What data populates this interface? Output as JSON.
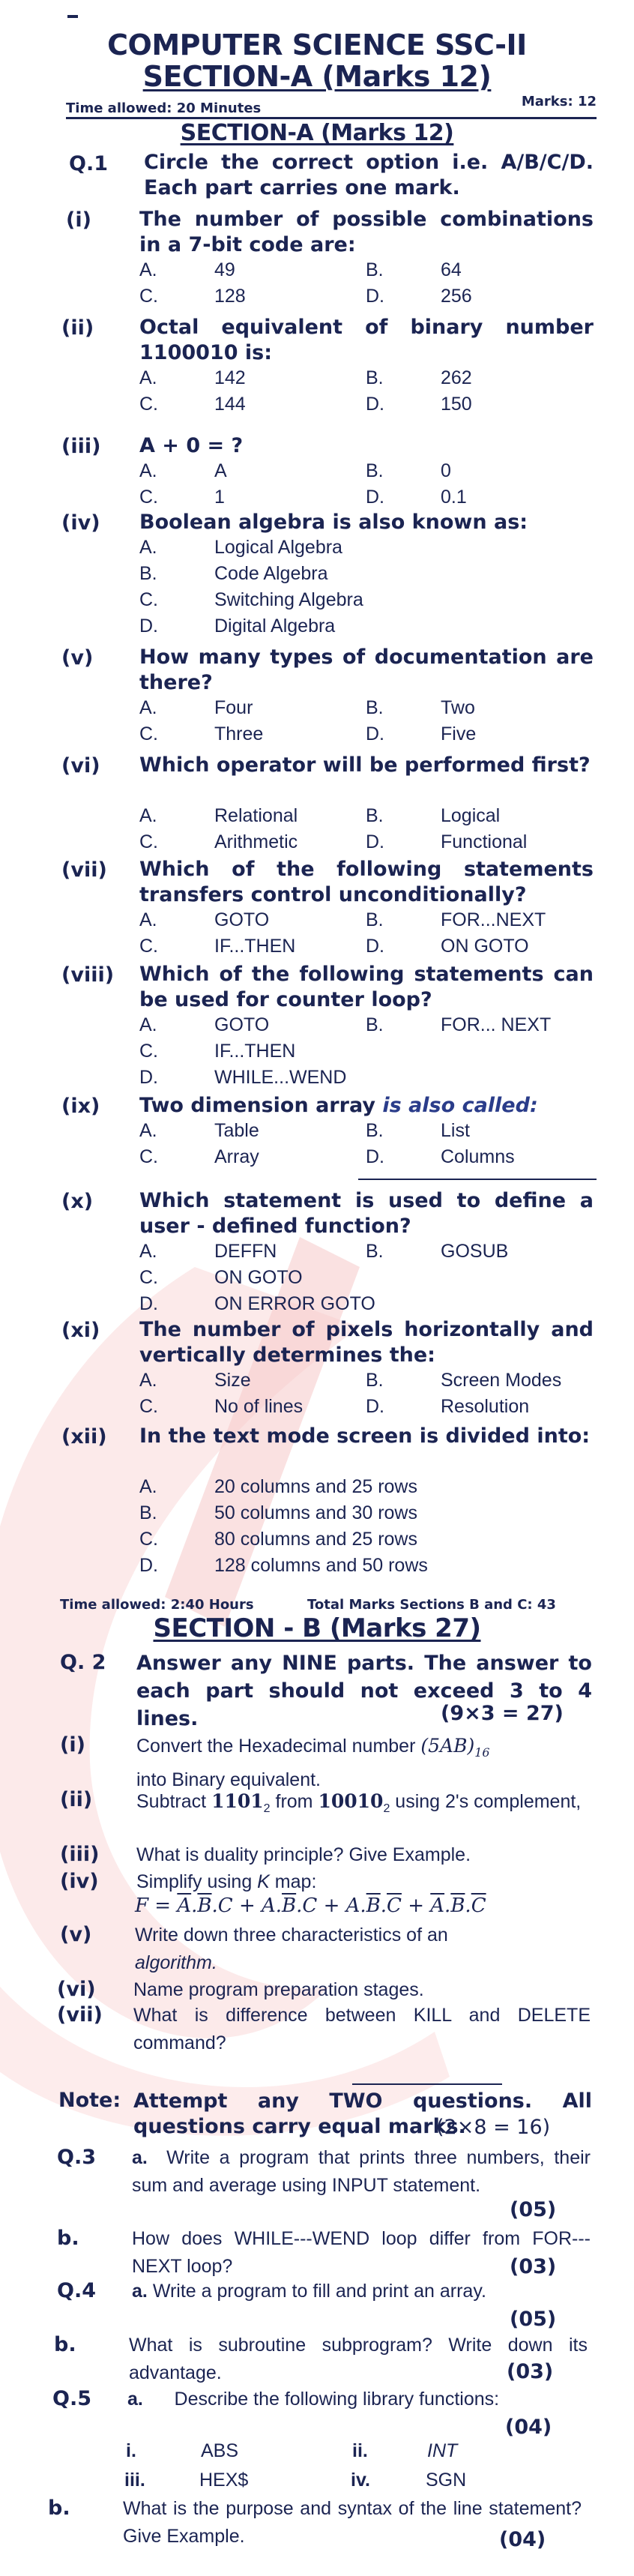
{
  "header": {
    "subject_title": "COMPUTER SCIENCE SSC-II",
    "section_a_heading": "SECTION-A (Marks 12)",
    "time_allowed": "Time allowed: 20 Minutes",
    "marks": "Marks: 12",
    "section_a_subheading": "SECTION-A (Marks 12)"
  },
  "section_a": {
    "q1_label": "Q.1",
    "q1_instructions": "Circle the correct option i.e. A/B/C/D. Each part carries one mark.",
    "mcqs": [
      {
        "num": "(i)",
        "question": "The number of possible combinations in a 7-bit code are:",
        "options": [
          [
            "A.",
            "49"
          ],
          [
            "B.",
            "64"
          ],
          [
            "C.",
            "128"
          ],
          [
            "D.",
            "256"
          ]
        ]
      },
      {
        "num": "(ii)",
        "question": "Octal equivalent of binary number 1100010 is:",
        "options": [
          [
            "A.",
            "142"
          ],
          [
            "B.",
            "262"
          ],
          [
            "C.",
            "144"
          ],
          [
            "D.",
            "150"
          ]
        ]
      },
      {
        "num": "(iii)",
        "question": "A + 0 = ?",
        "options": [
          [
            "A.",
            "A"
          ],
          [
            "B.",
            "0"
          ],
          [
            "C.",
            "1"
          ],
          [
            "D.",
            "0.1"
          ]
        ]
      },
      {
        "num": "(iv)",
        "question": "Boolean algebra is also known as:",
        "options": [
          [
            "A.",
            "Logical Algebra"
          ],
          [
            "B.",
            "Code Algebra"
          ],
          [
            "C.",
            "Switching Algebra"
          ],
          [
            "D.",
            "Digital Algebra"
          ]
        ]
      },
      {
        "num": "(v)",
        "question": "How many types of documentation are there?",
        "options": [
          [
            "A.",
            "Four"
          ],
          [
            "B.",
            "Two"
          ],
          [
            "C.",
            "Three"
          ],
          [
            "D.",
            "Five"
          ]
        ]
      },
      {
        "num": "(vi)",
        "question": "Which operator will be performed first?",
        "options": [
          [
            "A.",
            "Relational"
          ],
          [
            "B.",
            "Logical"
          ],
          [
            "C.",
            "Arithmetic"
          ],
          [
            "D.",
            "Functional"
          ]
        ]
      },
      {
        "num": "(vii)",
        "question": "Which of the following statements transfers control unconditionally?",
        "options": [
          [
            "A.",
            "GOTO"
          ],
          [
            "B.",
            "FOR...NEXT"
          ],
          [
            "C.",
            "IF...THEN"
          ],
          [
            "D.",
            "ON GOTO"
          ]
        ]
      },
      {
        "num": "(viii)",
        "question": "Which of the following statements can be used for counter loop?",
        "options": [
          [
            "A.",
            "GOTO"
          ],
          [
            "B.",
            "FOR... NEXT"
          ],
          [
            "C.",
            "IF...THEN"
          ],
          [
            "D.",
            "WHILE...WEND"
          ]
        ]
      },
      {
        "num": "(ix)",
        "question_main": "Two dimension array ",
        "question_tail": "is also called:",
        "options": [
          [
            "A.",
            "Table"
          ],
          [
            "B.",
            "List"
          ],
          [
            "C.",
            "Array"
          ],
          [
            "D.",
            "Columns"
          ]
        ]
      },
      {
        "num": "(x)",
        "question": "Which statement is used to define a user - defined function?",
        "options": [
          [
            "A.",
            "DEFFN"
          ],
          [
            "B.",
            "GOSUB"
          ],
          [
            "C.",
            "ON GOTO"
          ],
          [
            "D.",
            "ON ERROR GOTO"
          ]
        ]
      },
      {
        "num": "(xi)",
        "question": "The number of pixels horizontally and vertically determines the:",
        "options": [
          [
            "A.",
            "Size"
          ],
          [
            "B.",
            "Screen Modes"
          ],
          [
            "C.",
            "No of lines"
          ],
          [
            "D.",
            "Resolution"
          ]
        ]
      },
      {
        "num": "(xii)",
        "question": "In the text mode screen is divided into:",
        "options": [
          [
            "A.",
            "20 columns and 25 rows"
          ],
          [
            "B.",
            "50 columns and 30 rows"
          ],
          [
            "C.",
            "80 columns and 25 rows"
          ],
          [
            "D.",
            "128 columns and 50 rows"
          ]
        ]
      }
    ]
  },
  "section_bc_header": {
    "time_allowed": "Time allowed: 2:40 Hours",
    "total_marks": "Total Marks Sections B and C: 43"
  },
  "section_b": {
    "heading": "SECTION - B (Marks 27)",
    "q2_label": "Q. 2",
    "q2_instructions": "Answer any NINE parts. The answer to each part should not exceed 3 to 4 lines.",
    "q2_marks": "(9×3 = 27)",
    "parts": [
      {
        "num": "(i)",
        "pre": "Convert the Hexadecimal number ",
        "math": "(5AB)",
        "sub": "16",
        "post": "into Binary equivalent."
      },
      {
        "num": "(ii)",
        "pre": "Subtract ",
        "n1": "1101",
        "s1": "2",
        "mid": " from ",
        "n2": "10010",
        "s2": "2",
        "post": " using 2's complement,"
      },
      {
        "num": "(iii)",
        "text": "What is duality principle? Give Example."
      },
      {
        "num": "(iv)",
        "text_pre": "Simplify using ",
        "text_k": "K",
        "text_post": " map:",
        "formula": "F = A̅.B̅.C + A.B̅.C + A.B̅.C̅ + A̅.B̅.C̅"
      },
      {
        "num": "(v)",
        "text": "Write down three characteristics of an",
        "text_italic": "algorithm."
      },
      {
        "num": "(vi)",
        "text": "Name program preparation stages."
      },
      {
        "num": "(vii)",
        "text": "What is difference between KILL and DELETE command?"
      }
    ]
  },
  "section_c": {
    "note_label": "Note:",
    "note_text": "Attempt any TWO questions. All questions carry equal marks.",
    "note_marks": "(2×8 = 16)",
    "q3_label": "Q.3",
    "q3a_prefix": "a.",
    "q3a_text": "Write a program that prints three numbers, their sum and average using INPUT statement.",
    "q3a_marks": "(05)",
    "q3b_label": "b.",
    "q3b_text": "How does WHILE---WEND loop differ from FOR---NEXT loop?",
    "q3b_marks": "(03)",
    "q4_label": "Q.4",
    "q4a_prefix": "a.",
    "q4a_text": "Write a program to fill and print an array.",
    "q4a_marks": "(05)",
    "q4b_label": "b.",
    "q4b_text": "What is subroutine subprogram? Write down its advantage.",
    "q4b_marks": "(03)",
    "q5_label": "Q.5",
    "q5a_prefix": "a.",
    "q5a_text": "Describe the following library functions:",
    "q5a_marks": "(04)",
    "q5a_items": [
      [
        "i.",
        "ABS"
      ],
      [
        "ii.",
        "INT"
      ],
      [
        "iii.",
        "HEX$"
      ],
      [
        "iv.",
        "SGN"
      ]
    ],
    "q5b_label": "b.",
    "q5b_text": "What is the purpose and syntax of the line statement? Give Example.",
    "q5b_marks": "(04)"
  },
  "colors": {
    "ink": "#1b2452",
    "watermark": "#f7d4d4"
  }
}
